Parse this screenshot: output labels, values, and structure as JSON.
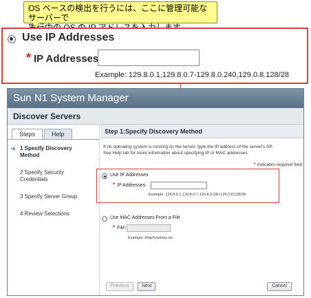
{
  "callout": {
    "line1": "OS ベースの検出を行うには、ここに管理可能なサーバーで",
    "line2": "実行中の OS の IP アドレスを入力します。"
  },
  "zoom": {
    "radio_label": "Use IP Addresses",
    "field_label": "IP Addresses:",
    "required_mark": "*",
    "field_value": "",
    "example": "Example: 129.8.0.1,129.8.0.7-129.8.0.240,129.0.8.128/28"
  },
  "window": {
    "title": "Sun N1 System Manager",
    "subheader": "Discover Servers"
  },
  "tabs": [
    {
      "label": "Steps",
      "active": true
    },
    {
      "label": "Help",
      "active": false
    }
  ],
  "steps": [
    {
      "line1": "1 Specify Discovery",
      "line2": "Method",
      "current": true
    },
    {
      "line1": "2 Specify Security",
      "line2": "Credentials",
      "current": false
    },
    {
      "line1": "3 Specify Server Group",
      "line2": "",
      "current": false
    },
    {
      "line1": "4 Review Selections",
      "line2": "",
      "current": false
    }
  ],
  "step_heading": "Step 1:Specify Discovery Method",
  "help_text": {
    "line1": "If no operating system is running on the server, type the IP address of the server's SP.",
    "line2": "See Help tab for more information about specifying IP or MAC addresses."
  },
  "required_note": "Indicates required field",
  "ip_option": {
    "radio_label": "Use IP Addresses",
    "field_label": "IP Addresses:",
    "example": "Example: 129.8.0.1,129.8.0.7-129.8.0.240,129.0.8.128/28",
    "selected": true
  },
  "mac_option": {
    "radio_label": "Use MAC Addresses From a File",
    "field_label": "File:",
    "example": "Example: /tmp/hostmac.txt",
    "selected": false
  },
  "buttons": {
    "previous": "Previous",
    "next": "Next",
    "cancel": "Cancel"
  },
  "icons": {
    "current_step": "arrow-right-icon"
  }
}
